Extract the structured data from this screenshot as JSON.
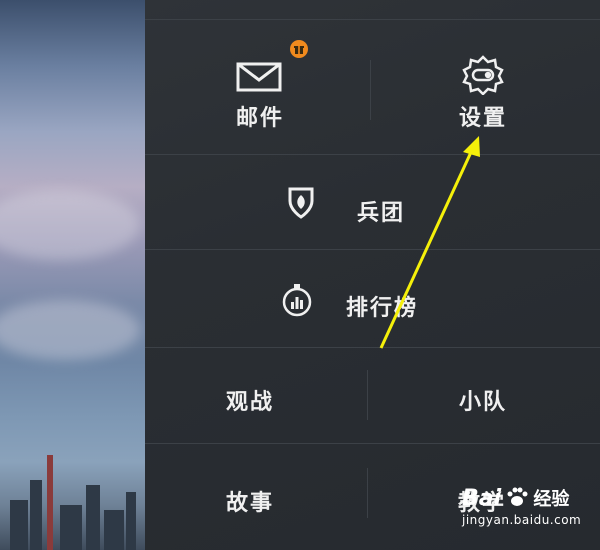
{
  "menu": {
    "mail_label": "邮件",
    "settings_label": "设置",
    "legion_label": "兵团",
    "leaderboard_label": "排行榜",
    "spectate_label": "观战",
    "squad_label": "小队",
    "story_label": "故事",
    "tutorial_label": "教学"
  },
  "icons": {
    "mail": "envelope-icon",
    "gift": "gift-badge-icon",
    "settings": "gear-toggle-icon",
    "legion": "shield-leaf-icon",
    "leaderboard": "stopwatch-bars-icon"
  },
  "watermark": {
    "brand": "Bai",
    "brand_suffix": "经验",
    "url": "jingyan.baidu.com"
  },
  "colors": {
    "panel": "#2b2f34",
    "text": "#f0f0f0",
    "badge": "#f08a1e",
    "annotation_arrow": "#f5f00a"
  }
}
